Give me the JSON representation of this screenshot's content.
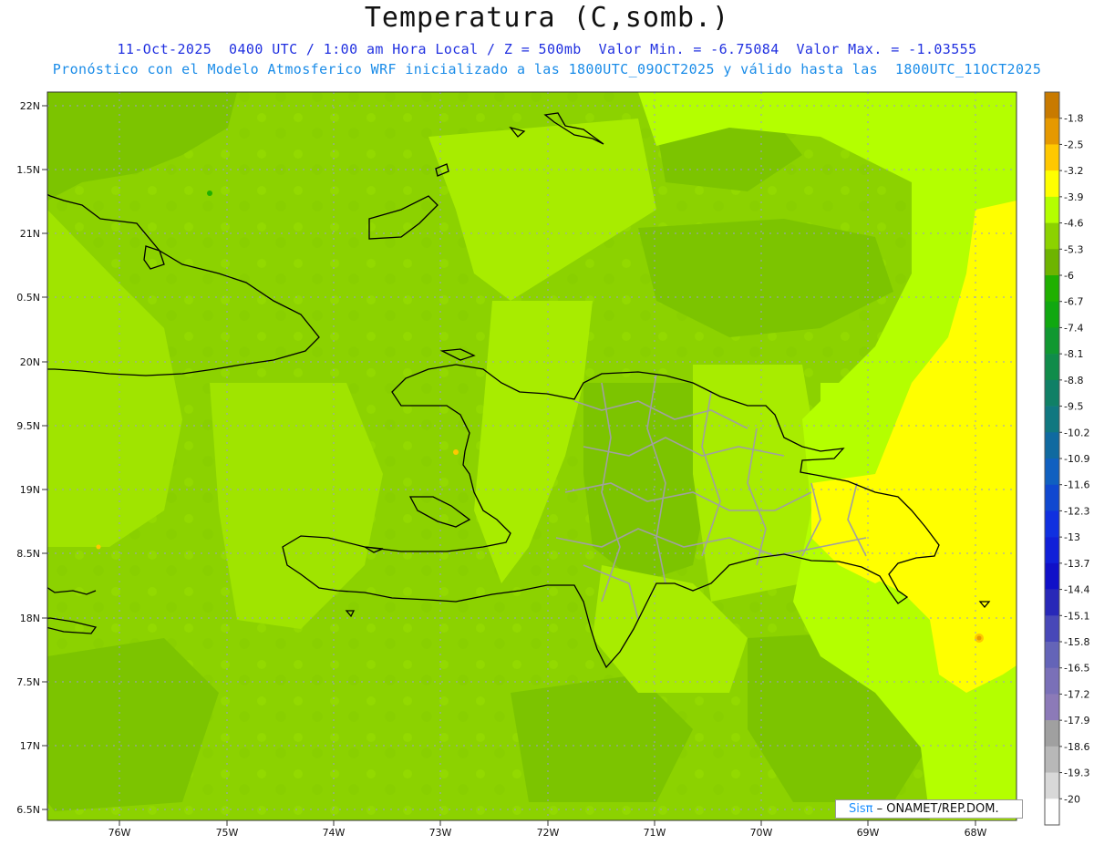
{
  "title": "Temperatura (C,somb.)",
  "subtitle_line1": "11-Oct-2025  0400 UTC / 1:00 am Hora Local / Z = 500mb  Valor Min. = -6.75084  Valor Max. = -1.03555",
  "subtitle_line2": "Pronóstico con el Modelo Atmosferico WRF inicializado a las 1800UTC_09OCT2025 y válido hasta las  1800UTC_11OCT2025",
  "lat_labels": [
    "22N",
    "1.5N",
    "21N",
    "0.5N",
    "20N",
    "9.5N",
    "19N",
    "8.5N",
    "18N",
    "7.5N",
    "17N",
    "6.5N"
  ],
  "lon_labels": [
    "76W",
    "75W",
    "74W",
    "73W",
    "72W",
    "71W",
    "70W",
    "69W",
    "68W"
  ],
  "colorbar": [
    {
      "label": "-1.8",
      "color": "#c87a00"
    },
    {
      "label": "-2.5",
      "color": "#e69900"
    },
    {
      "label": "-3.2",
      "color": "#ffc800"
    },
    {
      "label": "-3.9",
      "color": "#ffff00"
    },
    {
      "label": "-4.6",
      "color": "#b4ff00"
    },
    {
      "label": "-5.3",
      "color": "#8cd200"
    },
    {
      "label": "-6",
      "color": "#6eb400"
    },
    {
      "label": "-6.7",
      "color": "#20b000"
    },
    {
      "label": "-7.4",
      "color": "#10a810"
    },
    {
      "label": "-8.1",
      "color": "#109830"
    },
    {
      "label": "-8.8",
      "color": "#108c4a"
    },
    {
      "label": "-9.5",
      "color": "#108066"
    },
    {
      "label": "-10.2",
      "color": "#107880"
    },
    {
      "label": "-10.9",
      "color": "#106aa0"
    },
    {
      "label": "-11.6",
      "color": "#1060c0"
    },
    {
      "label": "-12.3",
      "color": "#1048d0"
    },
    {
      "label": "-13",
      "color": "#1030e0"
    },
    {
      "label": "-13.7",
      "color": "#1020d8"
    },
    {
      "label": "-14.4",
      "color": "#1010c8"
    },
    {
      "label": "-15.1",
      "color": "#2828b8"
    },
    {
      "label": "-15.8",
      "color": "#4848b8"
    },
    {
      "label": "-16.5",
      "color": "#6464b8"
    },
    {
      "label": "-17.2",
      "color": "#7a70b8"
    },
    {
      "label": "-17.9",
      "color": "#8c7ab8"
    },
    {
      "label": "-18.6",
      "color": "#a0a0a0"
    },
    {
      "label": "-19.3",
      "color": "#b8b8b8"
    },
    {
      "label": "-20",
      "color": "#d8d8d8"
    },
    {
      "label": "",
      "color": "#ffffff"
    }
  ],
  "credit_brand": "Sisπ",
  "credit_text": "– ONAMET/REP.DOM."
}
